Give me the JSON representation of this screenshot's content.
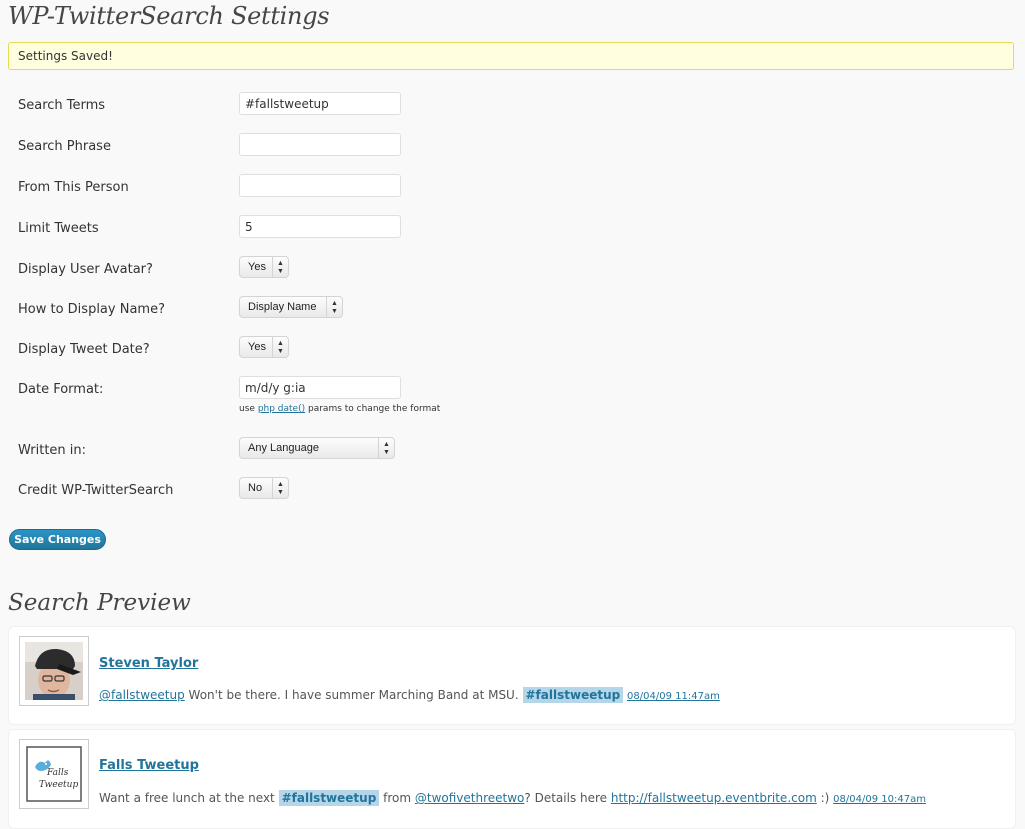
{
  "page": {
    "title": "WP-TwitterSearch Settings",
    "notice": "Settings Saved!"
  },
  "form": {
    "search_terms": {
      "label": "Search Terms",
      "value": "#fallstweetup"
    },
    "search_phrase": {
      "label": "Search Phrase",
      "value": ""
    },
    "from_person": {
      "label": "From This Person",
      "value": ""
    },
    "limit_tweets": {
      "label": "Limit Tweets",
      "value": "5"
    },
    "display_avatar": {
      "label": "Display User Avatar?",
      "value": "Yes"
    },
    "display_name": {
      "label": "How to Display Name?",
      "value": "Display Name"
    },
    "display_date": {
      "label": "Display Tweet Date?",
      "value": "Yes"
    },
    "date_format": {
      "label": "Date Format:",
      "value": "m/d/y g:ia",
      "hint_prefix": "use",
      "hint_link": "php date()",
      "hint_suffix": "params to change the format"
    },
    "written_in": {
      "label": "Written in:",
      "value": "Any Language"
    },
    "credit": {
      "label": "Credit WP-TwitterSearch",
      "value": "No"
    },
    "save_label": "Save Changes"
  },
  "preview": {
    "title": "Search Preview",
    "tweets": [
      {
        "user": "Steven Taylor",
        "mention": "@fallstweetup",
        "text": "Won't be there. I have summer Marching Band at MSU.",
        "hashtag": "#fallstweetup",
        "date": "08/04/09 11:47am"
      },
      {
        "user": "Falls Tweetup",
        "text_before": "Want a free lunch at the next",
        "hashtag": "#fallstweetup",
        "text_mid": "from",
        "mention": "@twofivethreetwo",
        "text_after": "? Details here",
        "link": "http://fallstweetup.eventbrite.com",
        "text_end": ":)",
        "date": "08/04/09 10:47am",
        "avatar_text": "Falls Tweetup"
      }
    ]
  },
  "icons": {
    "select_arrows": "up-down-arrows-icon"
  },
  "colors": {
    "link": "#21759b",
    "notice_bg": "#ffffe0",
    "notice_border": "#e6db55",
    "highlight": "#b5d5e9"
  }
}
